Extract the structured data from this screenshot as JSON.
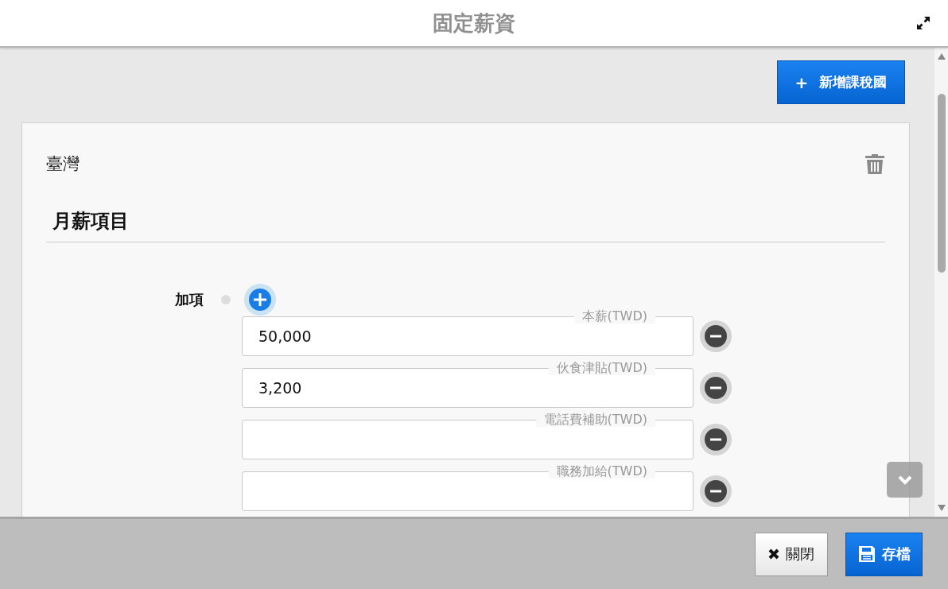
{
  "window": {
    "title": "固定薪資"
  },
  "add_country_button": {
    "icon": "+",
    "label": "新增課稅國"
  },
  "country_card": {
    "name": "臺灣",
    "section_title": "月薪項目",
    "group": {
      "label": "加項",
      "fields": [
        {
          "label": "本薪(TWD)",
          "value": "50,000"
        },
        {
          "label": "伙食津貼(TWD)",
          "value": "3,200"
        },
        {
          "label": "電話費補助(TWD)"
        },
        {
          "label": "職務加給(TWD)"
        }
      ]
    }
  },
  "footer": {
    "buttons": [
      {
        "kind": "close",
        "label": "關閉"
      },
      {
        "kind": "save",
        "label": "存檔"
      }
    ]
  }
}
